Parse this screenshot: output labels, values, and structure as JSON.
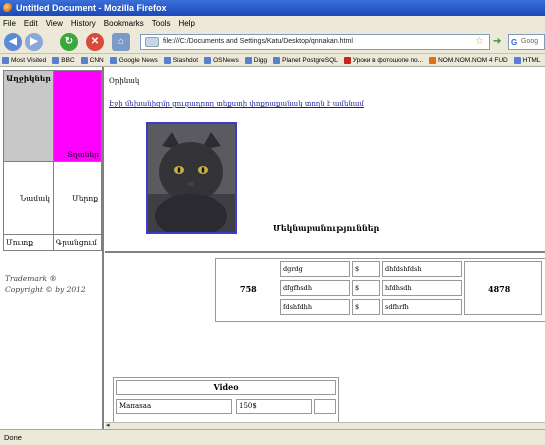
{
  "window": {
    "title": "Untitled Document - Mozilla Firefox"
  },
  "menu": [
    "File",
    "Edit",
    "View",
    "History",
    "Bookmarks",
    "Tools",
    "Help"
  ],
  "navigation": {
    "url": "file:///C:/Documents and Settings/Katu/Desktop/qnnakan.html",
    "search_placeholder": "Goog"
  },
  "bookmarks": [
    {
      "label": "Most Visited",
      "icon": "blue"
    },
    {
      "label": "BBC",
      "icon": "blue"
    },
    {
      "label": "CNN",
      "icon": "blue"
    },
    {
      "label": "Google News",
      "icon": "blue"
    },
    {
      "label": "Slashdot",
      "icon": "blue"
    },
    {
      "label": "OSNews",
      "icon": "blue"
    },
    {
      "label": "Digg",
      "icon": "blue"
    },
    {
      "label": "Planet PostgreSQL",
      "icon": "blue"
    },
    {
      "label": "Уроки в фотошопе по...",
      "icon": "red"
    },
    {
      "label": "NOM.NOM.NOM 4 FUD",
      "icon": "orange"
    },
    {
      "label": "HTML",
      "icon": "blue"
    }
  ],
  "left_frame": {
    "header": "Աղջիկներ",
    "magenta_label": "Տղաներ",
    "mid_left": "Նամակ",
    "mid_right": "Մերոք",
    "bottom_left": "Մուտք",
    "bottom_right": "Գրանցում",
    "trademark": "Trademark ®",
    "copyright": "Copyright © by 2012"
  },
  "main_frame": {
    "greeting": "Օրինակ",
    "link": "Էջի մեխանիզմը ցուցադրող տեքստի փոքրաքանակ տողն է ամենամ",
    "image_alt": "cat photo",
    "headline": "Մեկնաբանություններ"
  },
  "bottom_frame": {
    "left_number": "758",
    "right_number": "4878",
    "rows": [
      {
        "a": "dgrdg",
        "b": "$",
        "c": "dhfdshfdsh"
      },
      {
        "a": "dfgfhsdh",
        "b": "$",
        "c": "hfdhsdh"
      },
      {
        "a": "fdshfdhh",
        "b": "$",
        "c": "sdfhrfh"
      }
    ],
    "video": {
      "header": "Video",
      "name": "Мапаsaa",
      "price": "150$"
    }
  },
  "status": "Done"
}
